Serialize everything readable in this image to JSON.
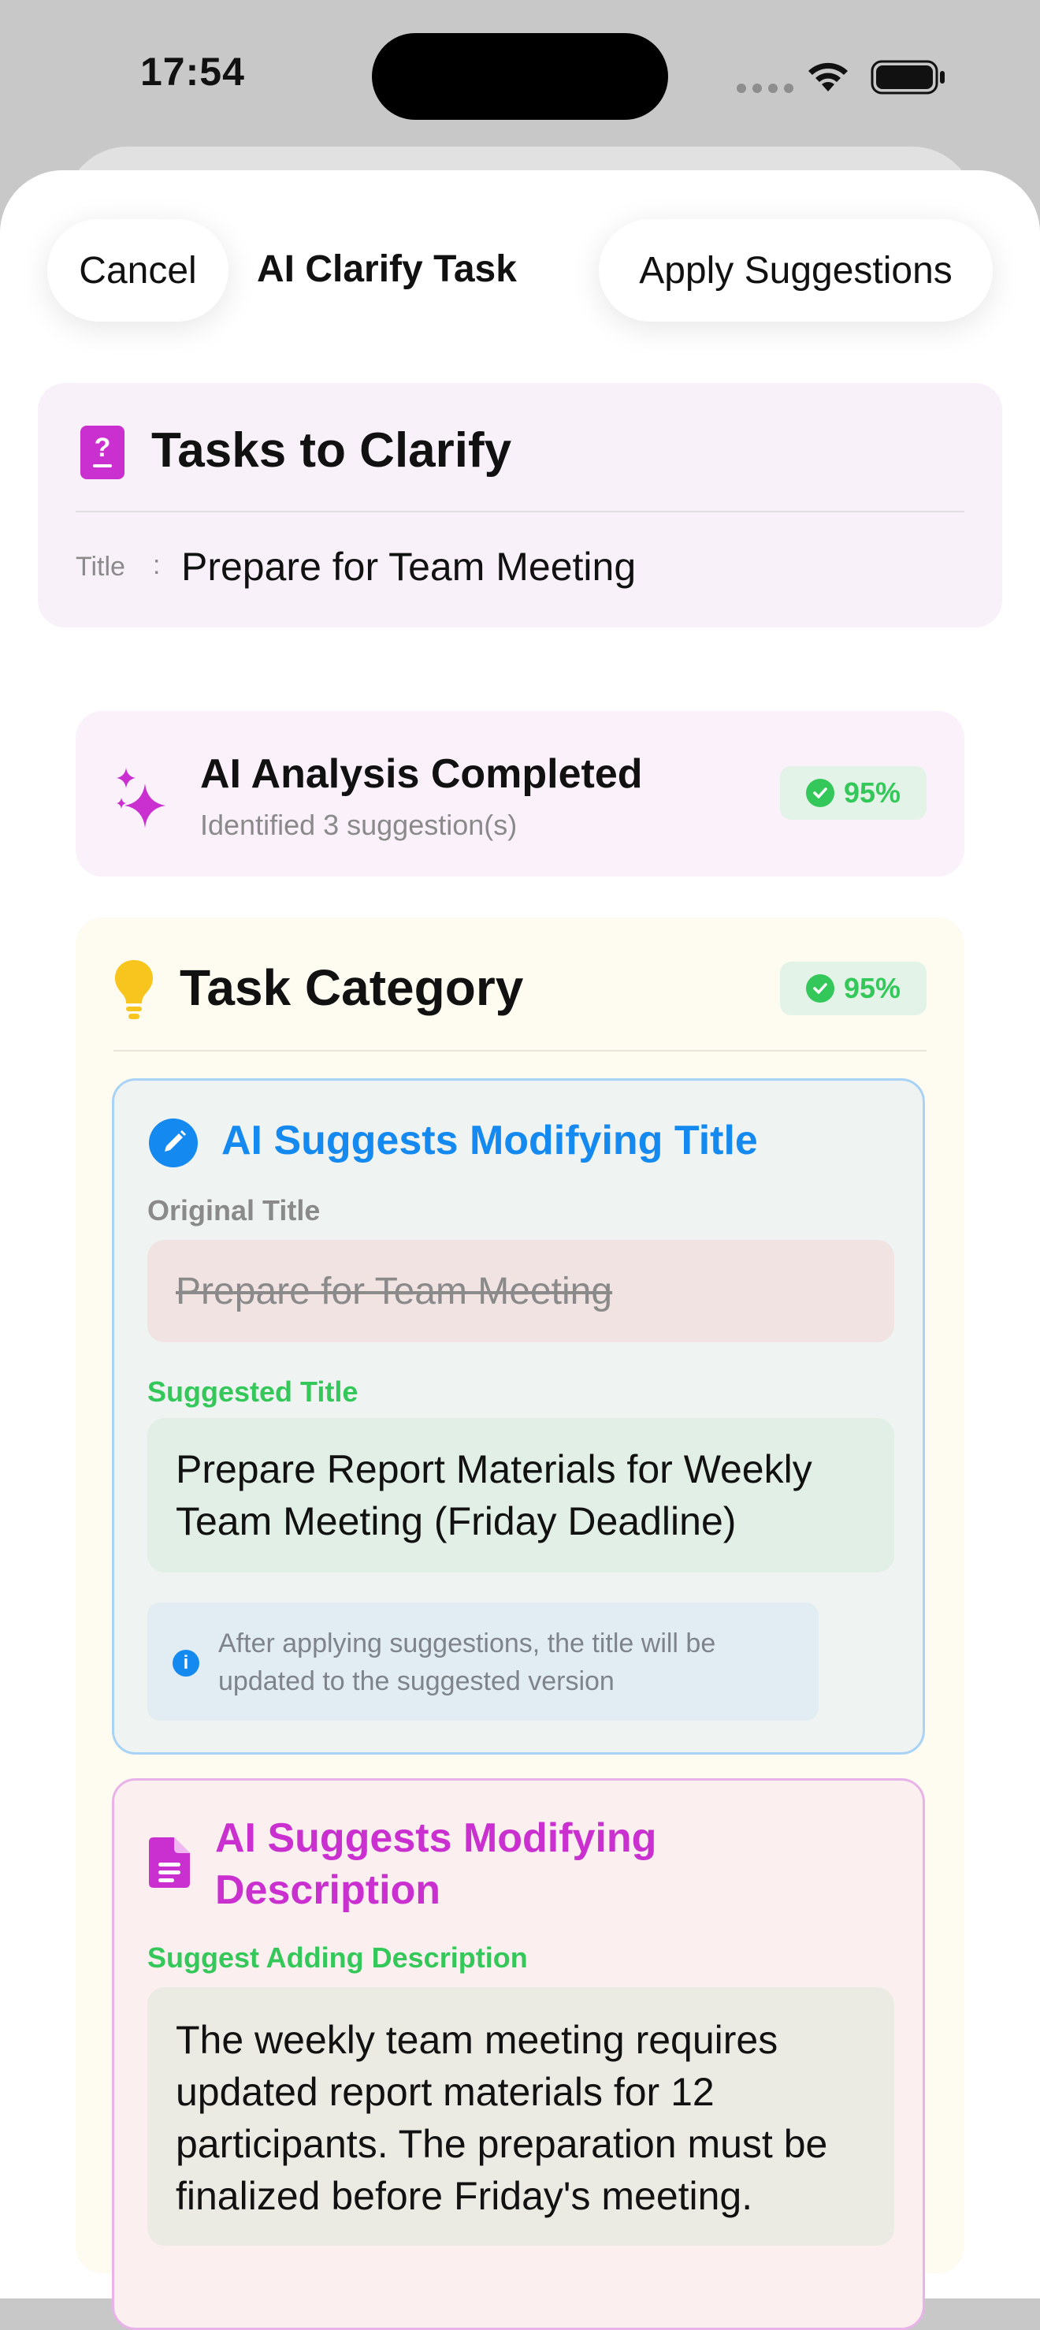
{
  "status_bar": {
    "time": "17:54",
    "icons": [
      "cellular-signal-icon",
      "wifi-icon",
      "battery-icon"
    ]
  },
  "nav": {
    "cancel_label": "Cancel",
    "title": "AI Clarify Task",
    "apply_label": "Apply Suggestions"
  },
  "clarify": {
    "heading": "Tasks to Clarify",
    "field_label": "Title",
    "separator": ":",
    "field_value": "Prepare for Team Meeting",
    "icon": "question-doc-icon"
  },
  "analysis": {
    "title": "AI Analysis Completed",
    "subtitle": "Identified 3 suggestion(s)",
    "confidence": "95%",
    "icon": "sparkles-icon"
  },
  "category": {
    "title": "Task Category",
    "confidence": "95%",
    "icon": "lightbulb-icon"
  },
  "title_suggestion": {
    "heading": "AI Suggests Modifying Title",
    "original_label": "Original Title",
    "original_value": "Prepare for Team Meeting",
    "suggested_label": "Suggested Title",
    "suggested_value": "Prepare Report Materials for Weekly Team Meeting (Friday Deadline)",
    "info_text": "After applying suggestions, the title will be updated to the suggested version",
    "icon": "pencil-circle-icon"
  },
  "description_suggestion": {
    "heading": "AI Suggests Modifying Description",
    "label": "Suggest Adding Description",
    "value": "The weekly team meeting requires updated report materials for 12 participants. The preparation must be finalized before Friday's meeting.",
    "icon": "document-icon"
  },
  "colors": {
    "accent_blue": "#1489f0",
    "accent_purple": "#c930cf",
    "success_green": "#34c759",
    "bulb_yellow": "#f7c51d"
  }
}
